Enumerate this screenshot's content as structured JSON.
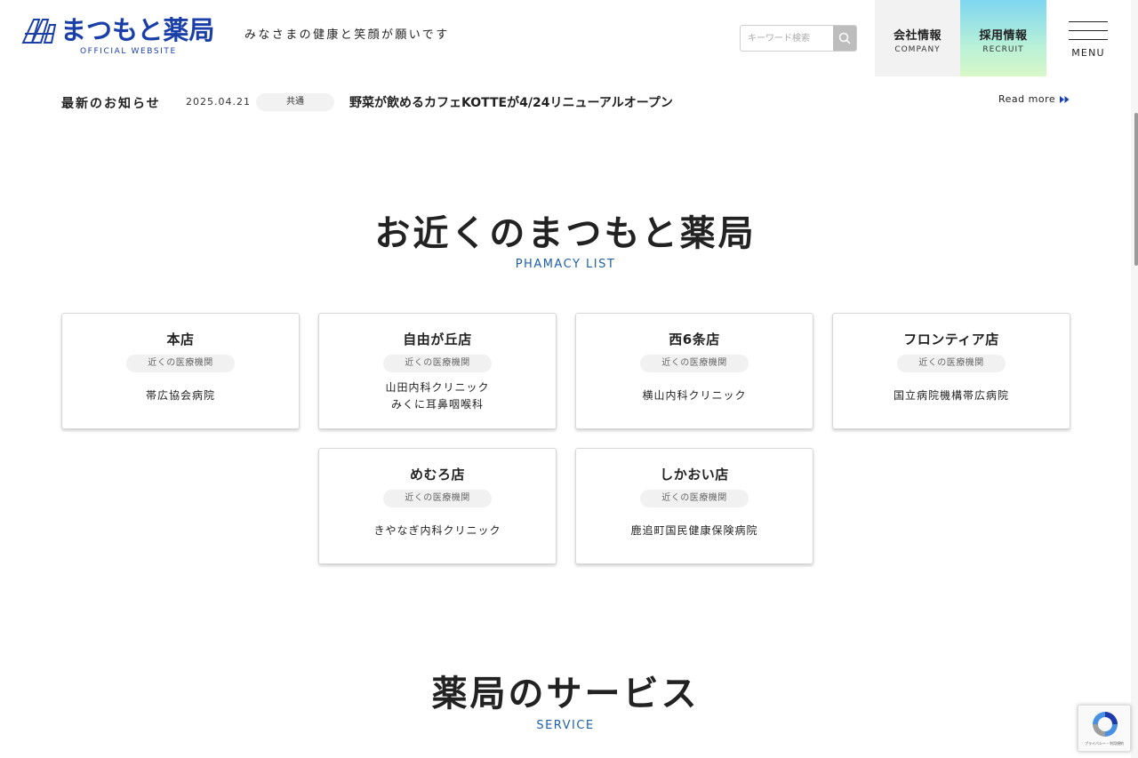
{
  "header": {
    "logo_text": "まつもと薬局",
    "logo_sub": "OFFICIAL WEBSITE",
    "tagline": "みなさまの健康と笑顔が願いです",
    "search_placeholder": "キーワード検索",
    "nav": {
      "company_jp": "会社情報",
      "company_en": "COMPANY",
      "recruit_jp": "採用情報",
      "recruit_en": "RECRUIT"
    },
    "menu_label": "MENU"
  },
  "news": {
    "title": "最新のお知らせ",
    "date": "2025.04.21",
    "category": "共通",
    "text": "野菜が飲めるカフェKOTTEが4/24リニューアルオープン",
    "more": "Read more"
  },
  "pharmacy_section": {
    "title": "お近くのまつもと薬局",
    "subtitle": "PHAMACY LIST",
    "badge_label": "近くの医療機関",
    "stores": [
      {
        "name": "本店",
        "hospitals": [
          "帯広協会病院"
        ]
      },
      {
        "name": "自由が丘店",
        "hospitals": [
          "山田内科クリニック",
          "みくに耳鼻咽喉科"
        ]
      },
      {
        "name": "西6条店",
        "hospitals": [
          "横山内科クリニック"
        ]
      },
      {
        "name": "フロンティア店",
        "hospitals": [
          "国立病院機構帯広病院"
        ]
      },
      {
        "name": "めむろ店",
        "hospitals": [
          "きやなぎ内科クリニック"
        ]
      },
      {
        "name": "しかおい店",
        "hospitals": [
          "鹿追町国民健康保険病院"
        ]
      }
    ]
  },
  "service_section": {
    "title": "薬局のサービス",
    "subtitle": "SERVICE"
  },
  "recaptcha": {
    "footer": "プライバシー・利用規約"
  },
  "colors": {
    "brand_blue": "#1a3fa8",
    "accent_blue": "#1f5fa8",
    "recruit_gradient_start": "#7ed6f0",
    "recruit_gradient_end": "#d8f8c8"
  }
}
